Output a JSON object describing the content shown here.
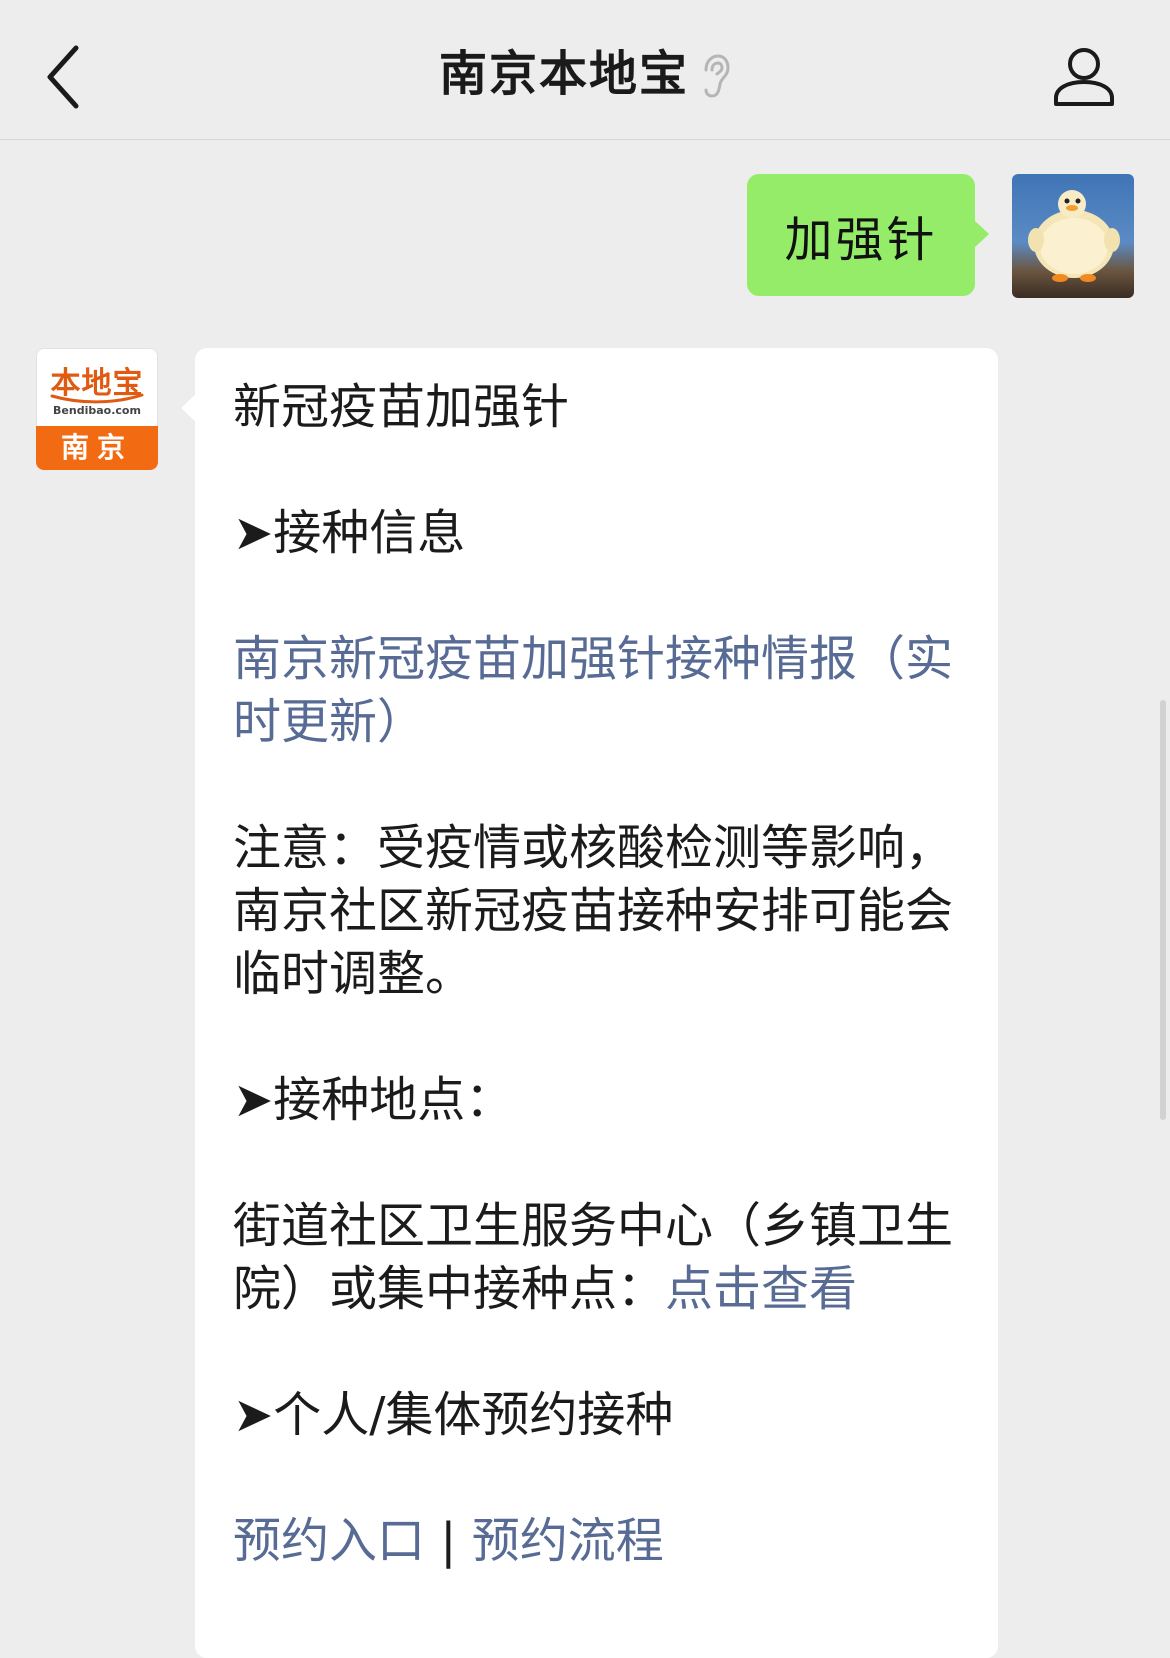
{
  "header": {
    "title": "南京本地宝",
    "back_icon": "chevron-left-icon",
    "ear_icon": "ear-icon",
    "profile_icon": "person-icon"
  },
  "outgoing": {
    "text": "加强针"
  },
  "bot": {
    "avatar": {
      "logo": "本地宝",
      "url": "Bendibao.com",
      "city": "南京"
    },
    "title": "新冠疫苗加强针",
    "section1": "➤接种信息",
    "link_realtime": "南京新冠疫苗加强针接种情报（实时更新）",
    "notice": "注意：受疫情或核酸检测等影响，南京社区新冠疫苗接种安排可能会临时调整。",
    "section2": "➤接种地点：",
    "location_text": "街道社区卫生服务中心（乡镇卫生院）或集中接种点：",
    "location_link": "点击查看",
    "section3": "➤个人/集体预约接种",
    "link_entry": "预约入口",
    "separator": "|",
    "link_process": "预约流程"
  },
  "colors": {
    "background": "#ededed",
    "outgoing_bubble": "#95ec69",
    "incoming_bubble": "#ffffff",
    "link": "#576b95",
    "brand_orange": "#f26a12"
  }
}
